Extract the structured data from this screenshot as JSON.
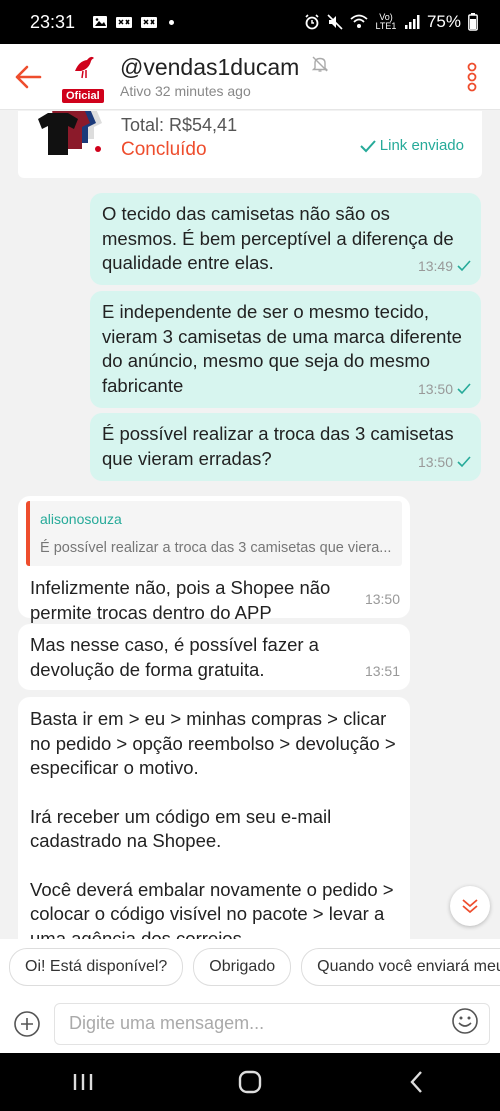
{
  "status_bar": {
    "time": "23:31",
    "battery": "75%",
    "network": "Vo) LTE1"
  },
  "header": {
    "shop_name": "@vendas1ducam",
    "badge": "Oficial",
    "status": "Ativo 32 minutes ago"
  },
  "order_card": {
    "total": "Total: R$54,41",
    "status": "Concluído",
    "link_label": "Link enviado"
  },
  "messages": [
    {
      "dir": "out",
      "text": "O tecido das camisetas não são os mesmos. É bem perceptível a diferença de qualidade entre elas.",
      "time": "13:49",
      "read": true
    },
    {
      "dir": "out",
      "text": "E independente de ser o mesmo tecido, vieram 3 camisetas de uma marca diferente do anúncio, mesmo que seja do mesmo fabricante",
      "time": "13:50",
      "read": true
    },
    {
      "dir": "out",
      "text": "É possível realizar a troca das 3 camisetas que vieram erradas?",
      "time": "13:50",
      "read": true
    },
    {
      "dir": "in",
      "quote_name": "alisonosouza",
      "quote_text": "É possível realizar a troca das 3 camisetas que viera...",
      "text": "Infelizmente não, pois a Shopee não permite trocas dentro do APP",
      "time": "13:50"
    },
    {
      "dir": "in",
      "text": "Mas nesse caso, é possível fazer a devolução de forma gratuita.",
      "time": "13:51"
    },
    {
      "dir": "in",
      "text_lines": [
        "Basta ir em > eu > minhas compras > clicar no pedido > opção reembolso > devolução > especificar o motivo.",
        "Irá receber um código em seu e-mail cadastrado na Shopee.",
        "Você deverá embalar novamente o pedido > colocar o código visível no pacote > levar a uma agência dos correios"
      ]
    }
  ],
  "quick_replies": [
    "Oi! Está disponível?",
    "Obrigado",
    "Quando você enviará meu pedido?"
  ],
  "input": {
    "placeholder": "Digite uma mensagem..."
  },
  "colors": {
    "accent": "#ee4d2d",
    "teal": "#26aa99",
    "outgoing_bubble": "#d7f5ef"
  }
}
